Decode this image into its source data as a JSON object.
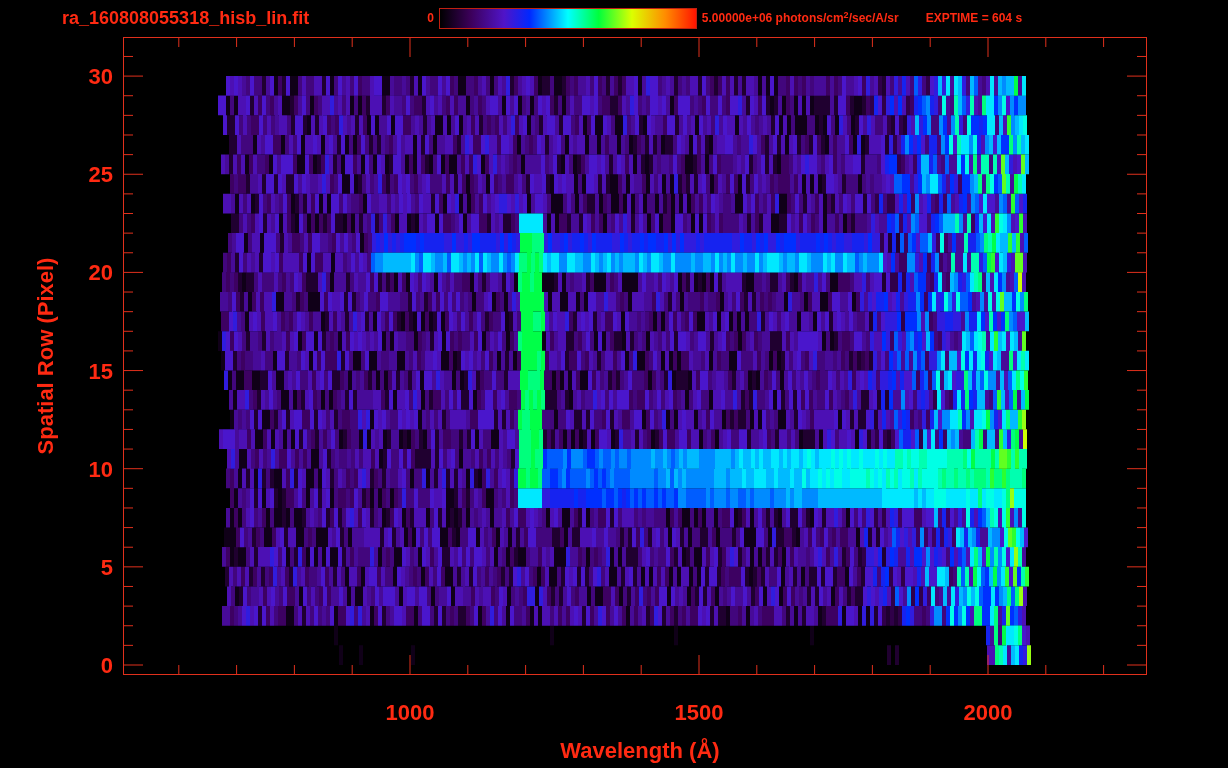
{
  "header": {
    "filename": "ra_160808055318_hisb_lin.fit",
    "colorbar": {
      "min_label": "0",
      "max_label": "5.00000e+06 photons/cm$^{2}$/sec/A/sr"
    },
    "exposure": "EXPTIME = 604 s"
  },
  "plot": {
    "ylabel": "Spatial Row (Pixel)",
    "xlabel": "Wavelength (Å)",
    "ytick_labels": [
      "30",
      "25",
      "20",
      "15",
      "10",
      "5",
      "0"
    ],
    "xtick_labels": [
      "1000",
      "1500",
      "2000"
    ]
  }
}
